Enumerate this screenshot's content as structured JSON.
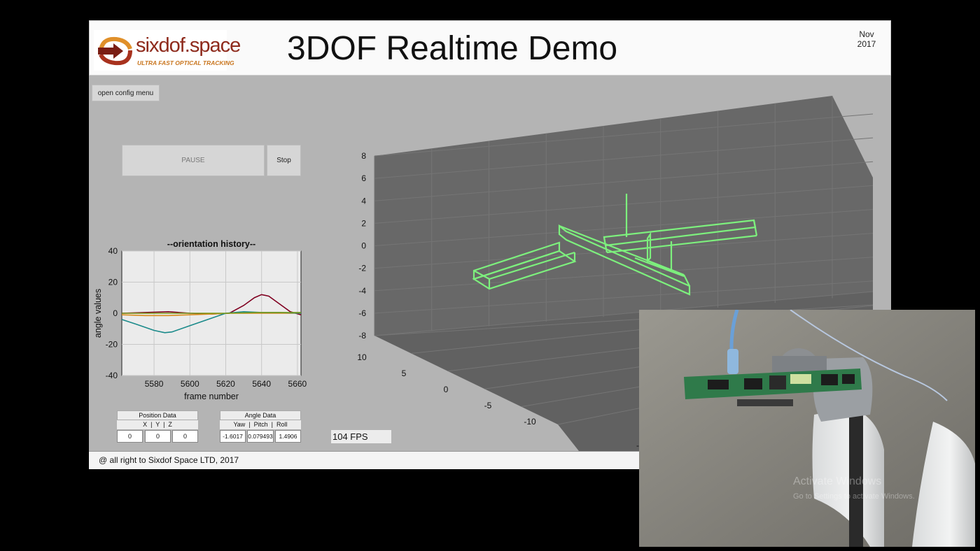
{
  "header": {
    "logo_text": "sixdof.space",
    "logo_tagline": "ULTRA FAST OPTICAL TRACKING",
    "title": "3DOF Realtime Demo",
    "date": "Nov 2017"
  },
  "controls": {
    "config_label": "open config menu",
    "pause_label": "PAUSE",
    "stop_label": "Stop"
  },
  "chart_data": {
    "type": "line",
    "title": "--orientation history--",
    "xlabel": "frame number",
    "ylabel": "angle values",
    "xlim": [
      5562,
      5662
    ],
    "ylim": [
      -40,
      40
    ],
    "xticks": [
      5580,
      5600,
      5620,
      5640,
      5660
    ],
    "yticks": [
      40,
      20,
      0,
      -20,
      -40
    ],
    "grid": true,
    "series": [
      {
        "color": "#800020",
        "x": [
          5562,
          5575,
          5588,
          5600,
          5612,
          5622,
          5630,
          5636,
          5640,
          5644,
          5650,
          5656,
          5662
        ],
        "y": [
          0,
          0.5,
          1,
          0,
          -0.5,
          0,
          5,
          10,
          12,
          11,
          6,
          1,
          -1
        ]
      },
      {
        "color": "#d98b1a",
        "x": [
          5562,
          5575,
          5588,
          5600,
          5612,
          5622,
          5640,
          5662
        ],
        "y": [
          -1,
          -1.5,
          -1.5,
          -1,
          -0.5,
          0,
          0,
          0
        ]
      },
      {
        "color": "#1a8a8a",
        "x": [
          5562,
          5570,
          5580,
          5586,
          5590,
          5600,
          5610,
          5620,
          5630,
          5640,
          5650,
          5662
        ],
        "y": [
          -4,
          -7,
          -11,
          -12.5,
          -12,
          -8,
          -4,
          0,
          1,
          0.5,
          0.5,
          0
        ]
      },
      {
        "color": "#7a9a1a",
        "x": [
          5562,
          5600,
          5620,
          5640,
          5662
        ],
        "y": [
          0,
          0,
          0,
          0.5,
          0.5
        ]
      }
    ]
  },
  "axes3d": {
    "zticks": [
      "8",
      "6",
      "4",
      "2",
      "0",
      "-2",
      "-4",
      "-6",
      "-8"
    ],
    "yticks": [
      "10",
      "5",
      "0",
      "-5",
      "-10"
    ],
    "xtick_partial": "-1",
    "model_color": "#7df07d"
  },
  "position_data": {
    "title": "Position Data",
    "header": "X  |  Y  |  Z",
    "values": [
      "0",
      "0",
      "0"
    ]
  },
  "angle_data": {
    "title": "Angle Data",
    "header": "Yaw  |  Pitch  |  Roll",
    "values": [
      "-1.6017",
      "0.079493",
      "1.4906"
    ]
  },
  "fps": "104 FPS",
  "footer": "@ all right to Sixdof Space LTD, 2017",
  "video_overlay": {
    "watermark_title": "Activate Windows",
    "watermark_sub": "Go to Settings to activate Windows."
  }
}
